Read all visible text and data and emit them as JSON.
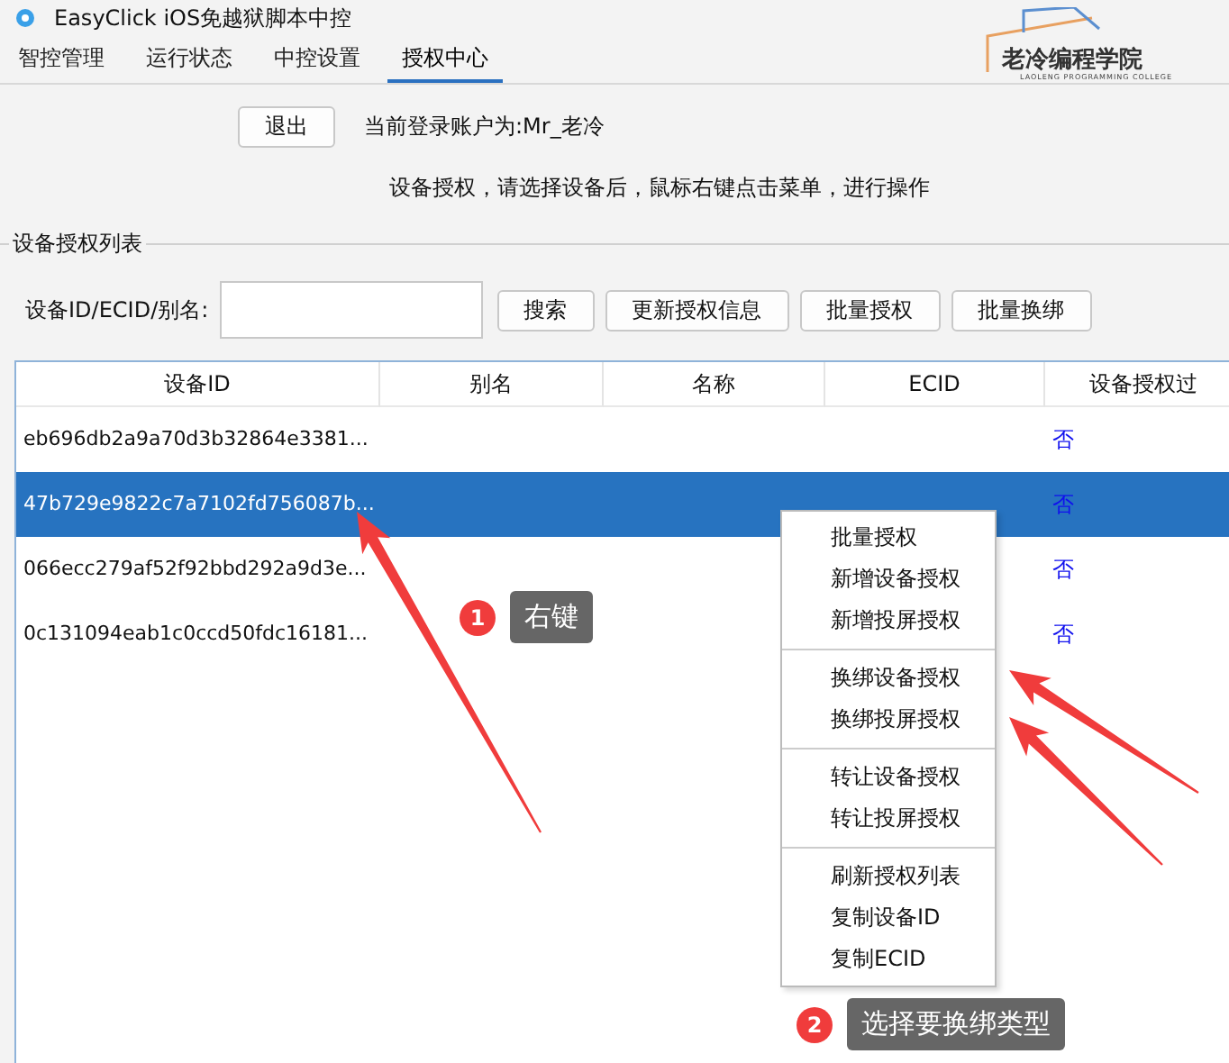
{
  "window": {
    "title": "EasyClick iOS免越狱脚本中控"
  },
  "tabs": [
    {
      "label": "智控管理",
      "selected": false
    },
    {
      "label": "运行状态",
      "selected": false
    },
    {
      "label": "中控设置",
      "selected": false
    },
    {
      "label": "授权中心",
      "selected": true
    }
  ],
  "logo": {
    "name": "老冷编程学院",
    "tagline": "LAOLENG PROGRAMMING COLLEGE"
  },
  "account": {
    "logout_button": "退出",
    "current_user": "当前登录账户为:Mr_老冷",
    "hint": "设备授权，请选择设备后，鼠标右键点击菜单，进行操作"
  },
  "device_list": {
    "title": "设备授权列表",
    "search_label": "设备ID/ECID/别名:",
    "buttons": [
      "搜索",
      "更新授权信息",
      "批量授权",
      "批量换绑"
    ],
    "columns": [
      "设备ID",
      "别名",
      "名称",
      "ECID",
      "设备授权过"
    ],
    "rows": [
      {
        "device_id": "eb696db2a9a70d3b32864e3381...",
        "authorized": "否",
        "selected": false
      },
      {
        "device_id": "47b729e9822c7a7102fd756087b...",
        "authorized": "否",
        "selected": true
      },
      {
        "device_id": "066ecc279af52f92bbd292a9d3e...",
        "authorized": "否",
        "selected": false
      },
      {
        "device_id": "0c131094eab1c0ccd50fdc16181...",
        "authorized": "否",
        "selected": false
      }
    ]
  },
  "context_menu": {
    "groups": [
      [
        "批量授权",
        "新增设备授权",
        "新增投屏授权"
      ],
      [
        "换绑设备授权",
        "换绑投屏授权"
      ],
      [
        "转让设备授权",
        "转让投屏授权"
      ],
      [
        "刷新授权列表",
        "复制设备ID",
        "复制ECID"
      ]
    ]
  },
  "annotations": [
    {
      "badge": "1",
      "text": "右键"
    },
    {
      "badge": "2",
      "text": "选择要换绑类型"
    }
  ]
}
